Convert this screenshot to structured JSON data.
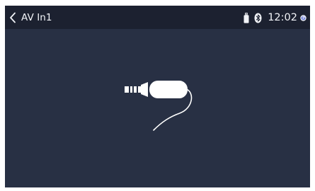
{
  "header": {
    "title": "AV In1"
  },
  "status": {
    "time": "12:02",
    "icons": [
      "usb-drive-icon",
      "bluetooth-icon",
      "notification-badge-icon"
    ]
  },
  "main": {
    "illustration": "av-plug-cable-icon"
  },
  "colors": {
    "screen_bg": "#283044",
    "status_bar_bg": "#1c2130",
    "foreground": "#f2f4f8"
  }
}
